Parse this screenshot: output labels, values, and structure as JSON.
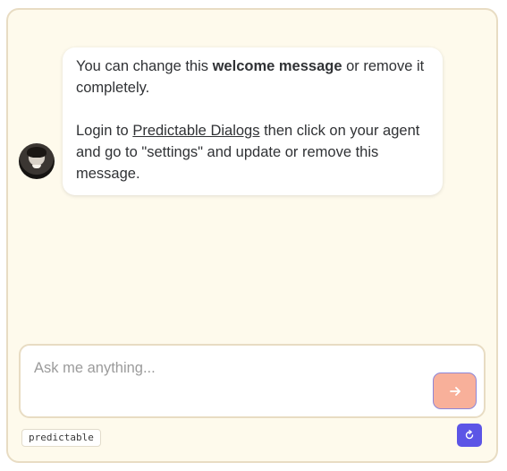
{
  "message": {
    "p1_before": "You can change this ",
    "p1_bold": "welcome message",
    "p1_after": " or remove it completely.",
    "p2_before": "Login to ",
    "p2_link": "Predictable Dialogs",
    "p2_after": " then click on your agent and go to \"settings\" and update or remove this message."
  },
  "input": {
    "placeholder": "Ask me anything...",
    "value": ""
  },
  "brand_tag": "predictable",
  "icons": {
    "avatar": "user-avatar",
    "send": "arrow-right-icon",
    "reset": "refresh-icon"
  },
  "colors": {
    "background": "#fefaec",
    "border": "#e8dcc3",
    "send_button": "#f8b09a",
    "reset_button": "#5c55e6"
  }
}
